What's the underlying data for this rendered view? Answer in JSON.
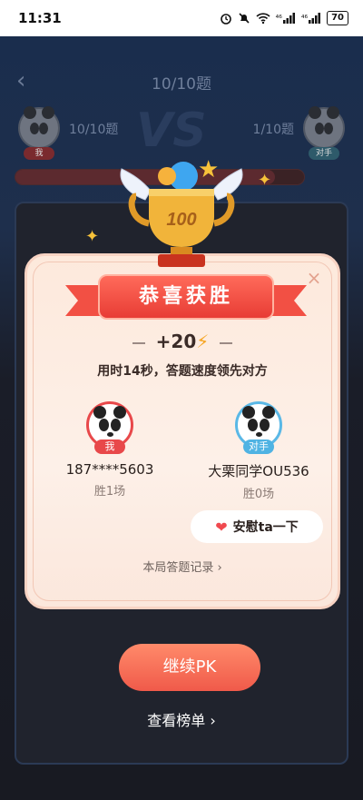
{
  "status_bar": {
    "time": "11:31",
    "signal_a": "⁴⁶",
    "signal_b": "⁴⁶",
    "battery": "70"
  },
  "game": {
    "round_title": "10/10题",
    "my_score": "10/10题",
    "opp_score": "1/10题",
    "my_tag": "我",
    "opp_tag": "对手",
    "vs": "VS",
    "progress_fraction": 0.9
  },
  "modal": {
    "title": "恭喜获胜",
    "close_symbol": "×",
    "points": "+20",
    "subtitle": "用时14秒，答题速度领先对方",
    "trophy_badge": "100",
    "me": {
      "tag": "我",
      "name": "187****5603",
      "wins": "胜1场"
    },
    "opponent": {
      "tag": "对手",
      "name": "大栗同学OU536",
      "wins": "胜0场"
    },
    "comfort_label": "安慰ta一下",
    "record_link": "本局答题记录 ›"
  },
  "actions": {
    "continue_label": "继续PK",
    "ranking_label": "查看榜单 ›"
  },
  "icons": {
    "back": "chevron-left-icon",
    "close": "close-icon",
    "heart": "hearts-icon",
    "bolt": "lightning-icon",
    "trophy": "trophy-icon"
  },
  "colors": {
    "accent": "#f05a4a",
    "me": "#e8484a",
    "opponent": "#4fb3e3",
    "bolt": "#f6a522"
  }
}
